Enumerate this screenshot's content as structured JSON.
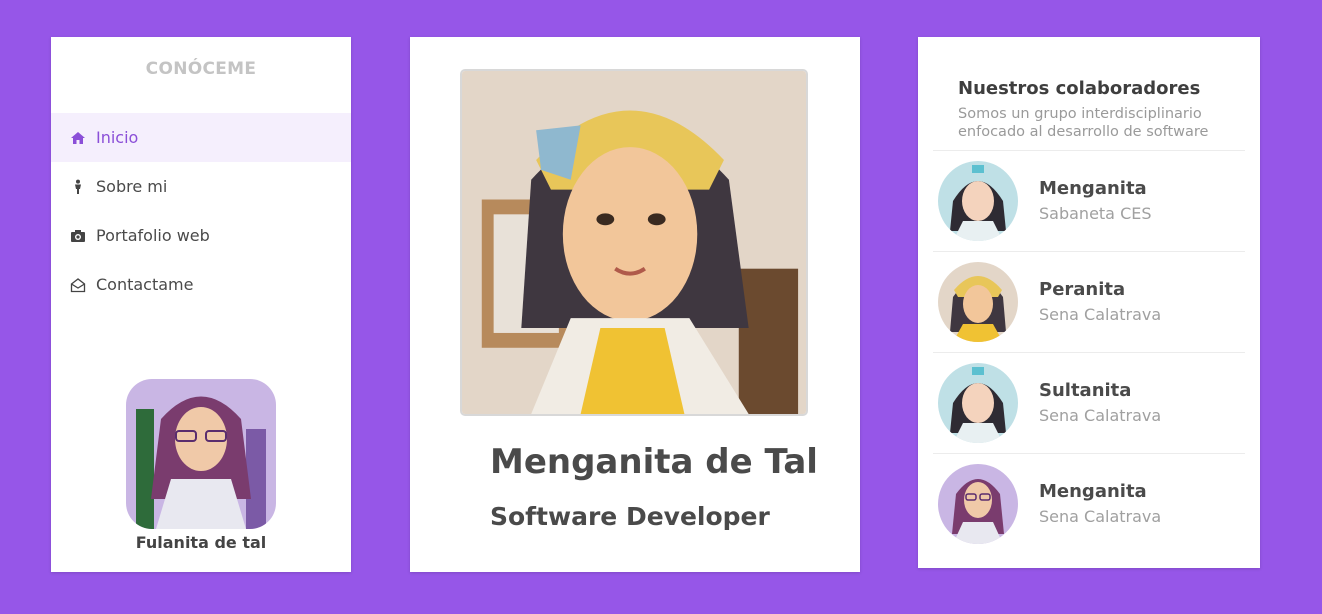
{
  "sidebar": {
    "brand": "CONÓCEME",
    "items": [
      {
        "label": "Inicio",
        "icon": "home-icon",
        "active": true
      },
      {
        "label": "Sobre mi",
        "icon": "person-icon",
        "active": false
      },
      {
        "label": "Portafolio web",
        "icon": "camera-icon",
        "active": false
      },
      {
        "label": "Contactame",
        "icon": "envelope-open-icon",
        "active": false
      }
    ],
    "profile_name": "Fulanita de tal"
  },
  "main": {
    "name": "Menganita de Tal",
    "role": "Software Developer"
  },
  "collaborators": {
    "title": "Nuestros colaboradores",
    "subtitle": "Somos un grupo interdisciplinario enfocado al desarrollo de software",
    "items": [
      {
        "name": "Menganita",
        "org": "Sabaneta CES"
      },
      {
        "name": "Peranita",
        "org": "Sena Calatrava"
      },
      {
        "name": "Sultanita",
        "org": "Sena Calatrava"
      },
      {
        "name": "Menganita",
        "org": "Sena Calatrava"
      }
    ]
  },
  "colors": {
    "background": "#9656e8",
    "accent": "#8b4fd8",
    "active_bg": "#f5effd"
  }
}
